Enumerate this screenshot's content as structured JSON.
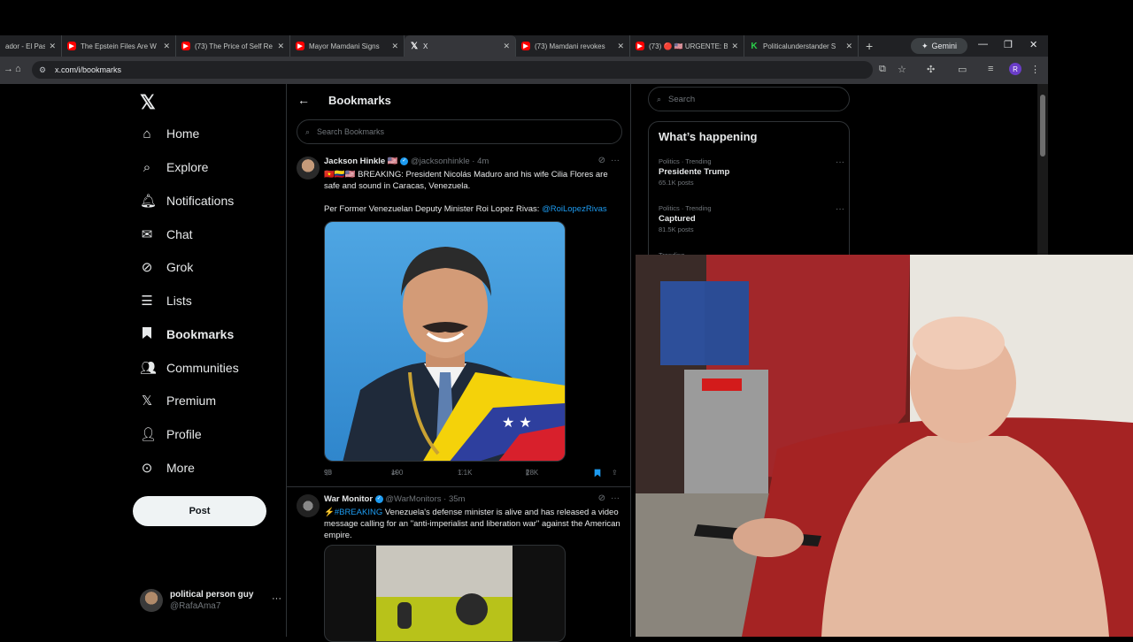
{
  "browser": {
    "tabs": [
      {
        "title": "ador - El Pas",
        "icon": "youtube-icon"
      },
      {
        "title": "The Epstein Files Are W",
        "icon": "youtube-icon"
      },
      {
        "title": "(73) The Price of Self Re",
        "icon": "youtube-icon"
      },
      {
        "title": "Mayor Mamdani Signs",
        "icon": "youtube-icon"
      },
      {
        "title": "X",
        "icon": "x-logo-icon",
        "active": true
      },
      {
        "title": "(73) Mamdani revokes",
        "icon": "youtube-icon"
      },
      {
        "title": "(73) 🔴 🇺🇸 URGENTE: B",
        "icon": "youtube-icon"
      },
      {
        "title": "Politicalunderstander S",
        "icon": "politicalunderstander-icon"
      }
    ],
    "gemini_label": "Gemini",
    "url": "x.com/i/bookmarks",
    "profile_initial": "R"
  },
  "nav": {
    "items": [
      {
        "label": "Home",
        "icon": "home-icon"
      },
      {
        "label": "Explore",
        "icon": "search-icon"
      },
      {
        "label": "Notifications",
        "icon": "bell-icon"
      },
      {
        "label": "Chat",
        "icon": "mail-icon"
      },
      {
        "label": "Grok",
        "icon": "grok-icon"
      },
      {
        "label": "Lists",
        "icon": "list-icon"
      },
      {
        "label": "Bookmarks",
        "icon": "bookmark-icon",
        "active": true
      },
      {
        "label": "Communities",
        "icon": "communities-icon"
      },
      {
        "label": "Premium",
        "icon": "x-logo-icon"
      },
      {
        "label": "Profile",
        "icon": "person-icon"
      },
      {
        "label": "More",
        "icon": "more-circle-icon"
      }
    ],
    "post_label": "Post",
    "account": {
      "name": "political person guy",
      "handle": "@RafaAma7"
    }
  },
  "main": {
    "title": "Bookmarks",
    "search_placeholder": "Search Bookmarks",
    "tweets": [
      {
        "name": "Jackson Hinkle",
        "name_flag": "🇺🇸",
        "handle": "@jacksonhinkle",
        "time": "4m",
        "text_prefix": "🇻🇳🇨🇴🇺🇸",
        "text": "BREAKING: President Nicolás Maduro and his wife Cilia Flores are safe and sound in Caracas, Venezuela.",
        "text2": "Per Former Venezuelan Deputy Minister Roi Lopez Rivas:",
        "link": "@RoiLopezRivas",
        "replies": "98",
        "reposts": "190",
        "likes": "1.1K",
        "views": "28K"
      },
      {
        "name": "War Monitor",
        "handle": "@WarMonitors",
        "time": "35m",
        "hashtag": "⚡#BREAKING",
        "text": "Venezuela's defense minister is alive and has released a video message calling for an \"anti-imperialist and liberation war\" against the American empire."
      }
    ]
  },
  "right": {
    "search_placeholder": "Search",
    "happening_title": "What’s happening",
    "trends": [
      {
        "meta": "Politics · Trending",
        "name": "Presidente Trump",
        "count": "65.1K posts"
      },
      {
        "meta": "Politics · Trending",
        "name": "Captured",
        "count": "81.5K posts"
      },
      {
        "meta": "Trending",
        "name": "",
        "count": ""
      }
    ]
  },
  "colors": {
    "accent": "#1d9bf0",
    "background": "#000000",
    "border": "#2f3336",
    "muted_text": "#71767b"
  }
}
